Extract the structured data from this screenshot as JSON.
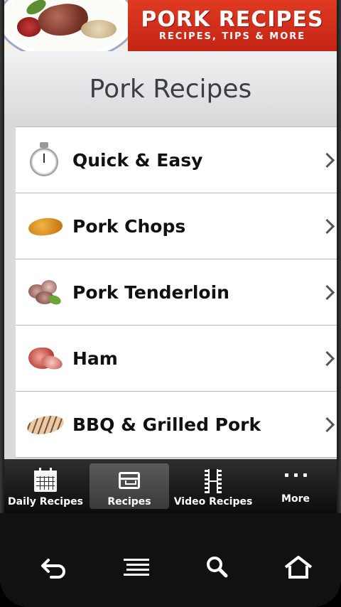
{
  "banner": {
    "title": "PORK RECIPES",
    "subtitle": "RECIPES, TIPS & MORE"
  },
  "page": {
    "title": "Pork Recipes"
  },
  "list": {
    "items": [
      {
        "label": "Quick & Easy",
        "icon": "stopwatch-icon"
      },
      {
        "label": "Pork Chops",
        "icon": "pork-chop-icon"
      },
      {
        "label": "Pork Tenderloin",
        "icon": "tenderloin-icon"
      },
      {
        "label": "Ham",
        "icon": "ham-icon"
      },
      {
        "label": "BBQ & Grilled Pork",
        "icon": "grilled-pork-icon"
      }
    ]
  },
  "tabs": [
    {
      "label": "Daily Recipes",
      "icon": "calendar-icon",
      "active": false
    },
    {
      "label": "Recipes",
      "icon": "inbox-tray-icon",
      "active": true
    },
    {
      "label": "Video Recipes",
      "icon": "film-strip-icon",
      "active": false
    },
    {
      "label": "More",
      "icon": "more-dots-icon",
      "active": false
    }
  ],
  "system_nav": [
    {
      "icon": "back-icon"
    },
    {
      "icon": "menu-icon"
    },
    {
      "icon": "search-icon"
    },
    {
      "icon": "home-icon"
    }
  ],
  "colors": {
    "banner_red": "#d52d18",
    "title_text": "#3b3f45",
    "tab_bg": "#1a1a1a",
    "active_tab_bg": "#4a4a4a"
  }
}
